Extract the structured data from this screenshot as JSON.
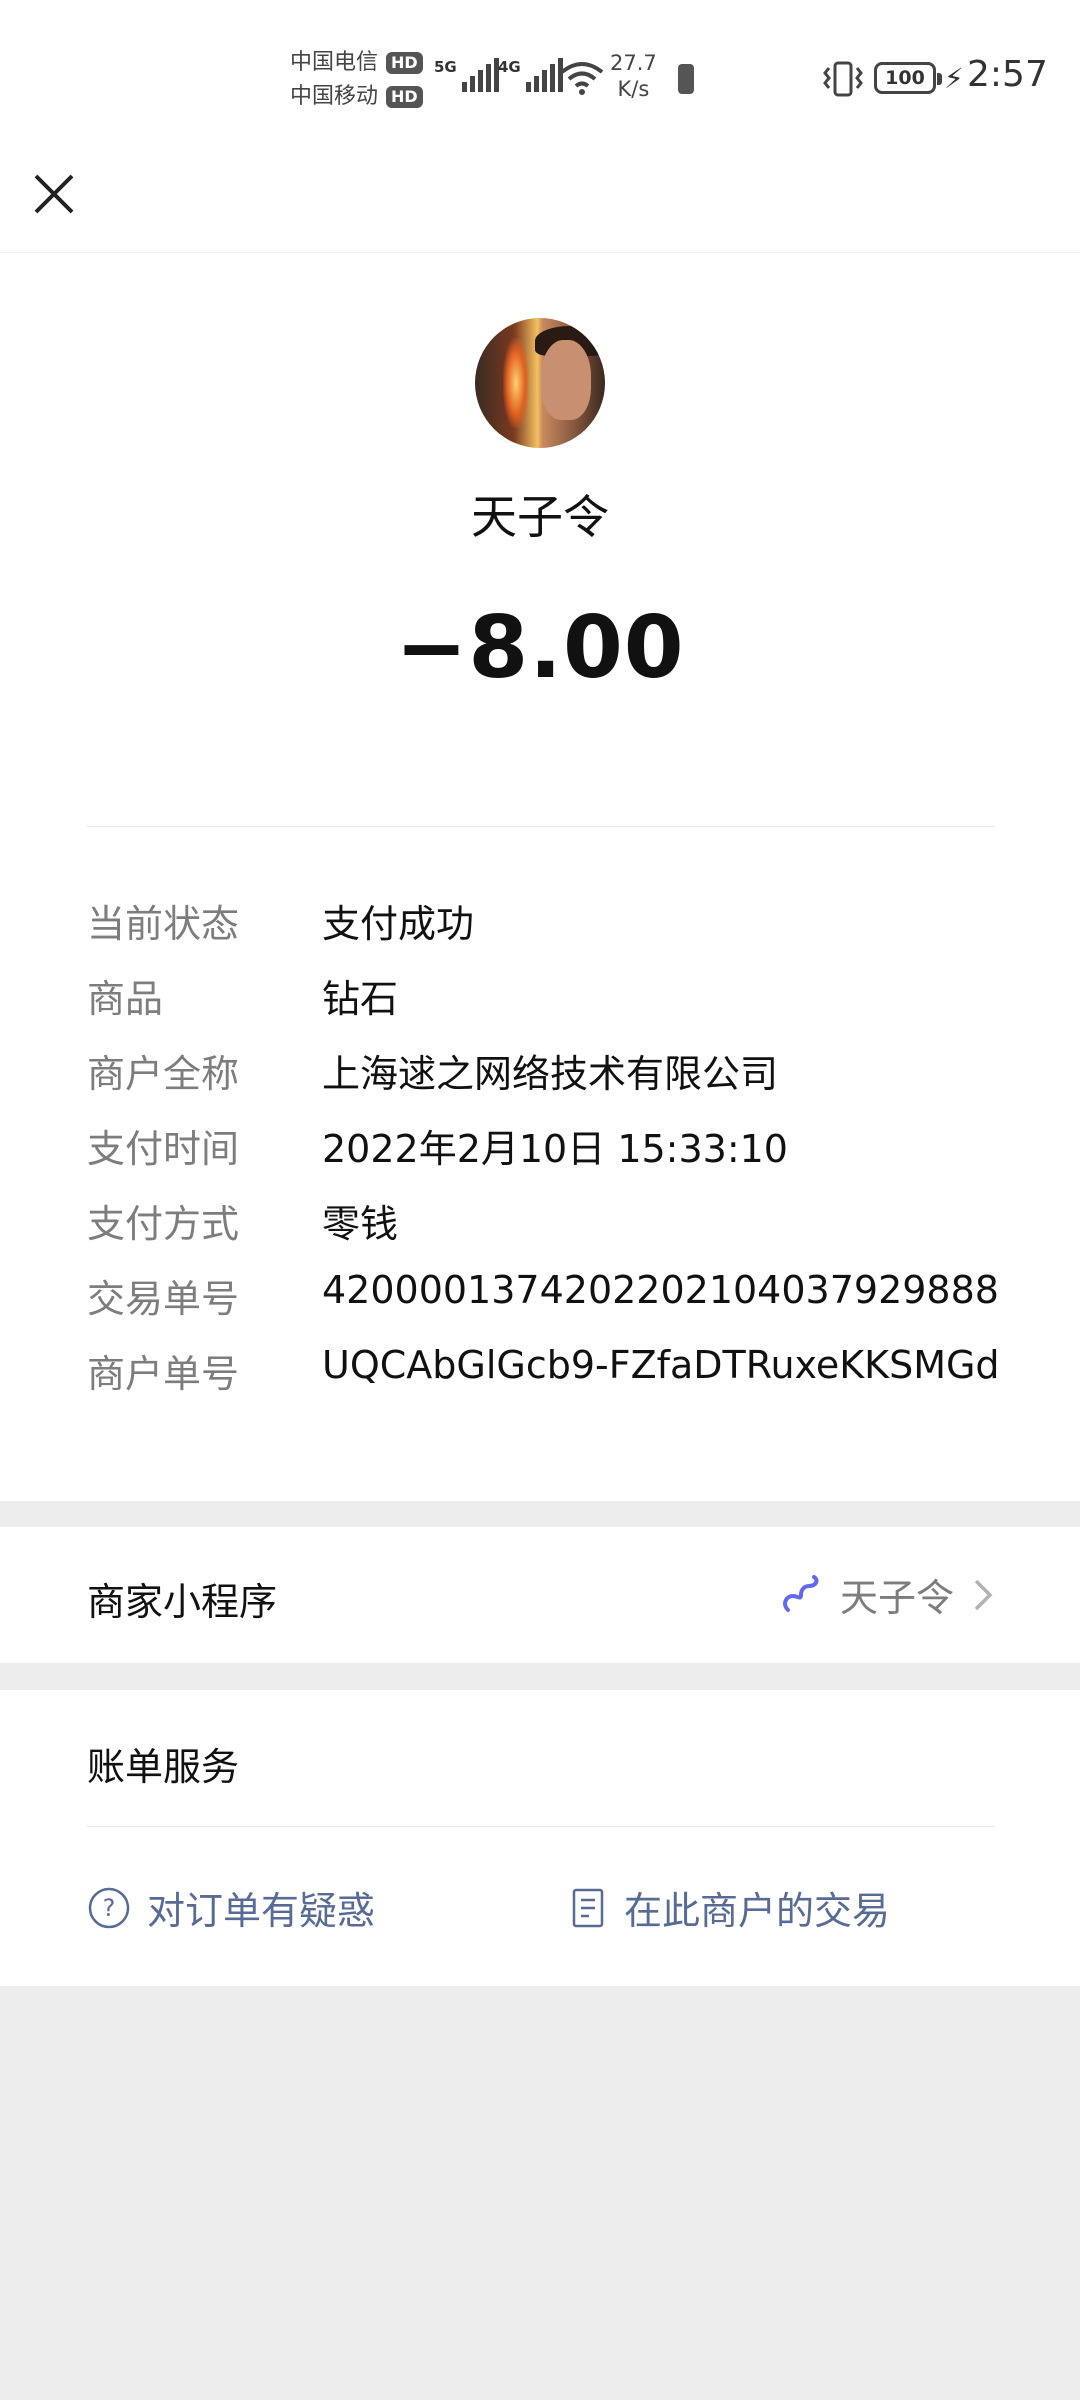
{
  "status_bar": {
    "carrier_1": "中国电信",
    "carrier_2": "中国移动",
    "hd_badge": "HD",
    "network_1": "5G",
    "network_2": "4G",
    "speed_value": "27.7",
    "speed_unit": "K/s",
    "battery": "100",
    "time": "2:57"
  },
  "nav": {
    "close_icon": "close-icon"
  },
  "header": {
    "merchant_name": "天子令",
    "amount": "−8.00"
  },
  "details": [
    {
      "label": "当前状态",
      "value": "支付成功"
    },
    {
      "label": "商品",
      "value": "钻石"
    },
    {
      "label": "商户全称",
      "value": "上海逑之网络技术有限公司"
    },
    {
      "label": "支付时间",
      "value": "2022年2月10日 15:33:10"
    },
    {
      "label": "支付方式",
      "value": "零钱"
    },
    {
      "label": "交易单号",
      "value": "4200001374202202104037929888"
    },
    {
      "label": "商户单号",
      "value": "UQCAbGlGcb9-FZfaDTRuxeKKSMGd"
    }
  ],
  "mini_program": {
    "label": "商家小程序",
    "value": "天子令",
    "icon": "mini-program-link-icon"
  },
  "bill_services": {
    "title": "账单服务",
    "link_question": "对订单有疑惑",
    "link_transactions": "在此商户的交易"
  },
  "colors": {
    "link": "#576b95",
    "background": "#ededed",
    "label_gray": "#7d7d7d"
  }
}
